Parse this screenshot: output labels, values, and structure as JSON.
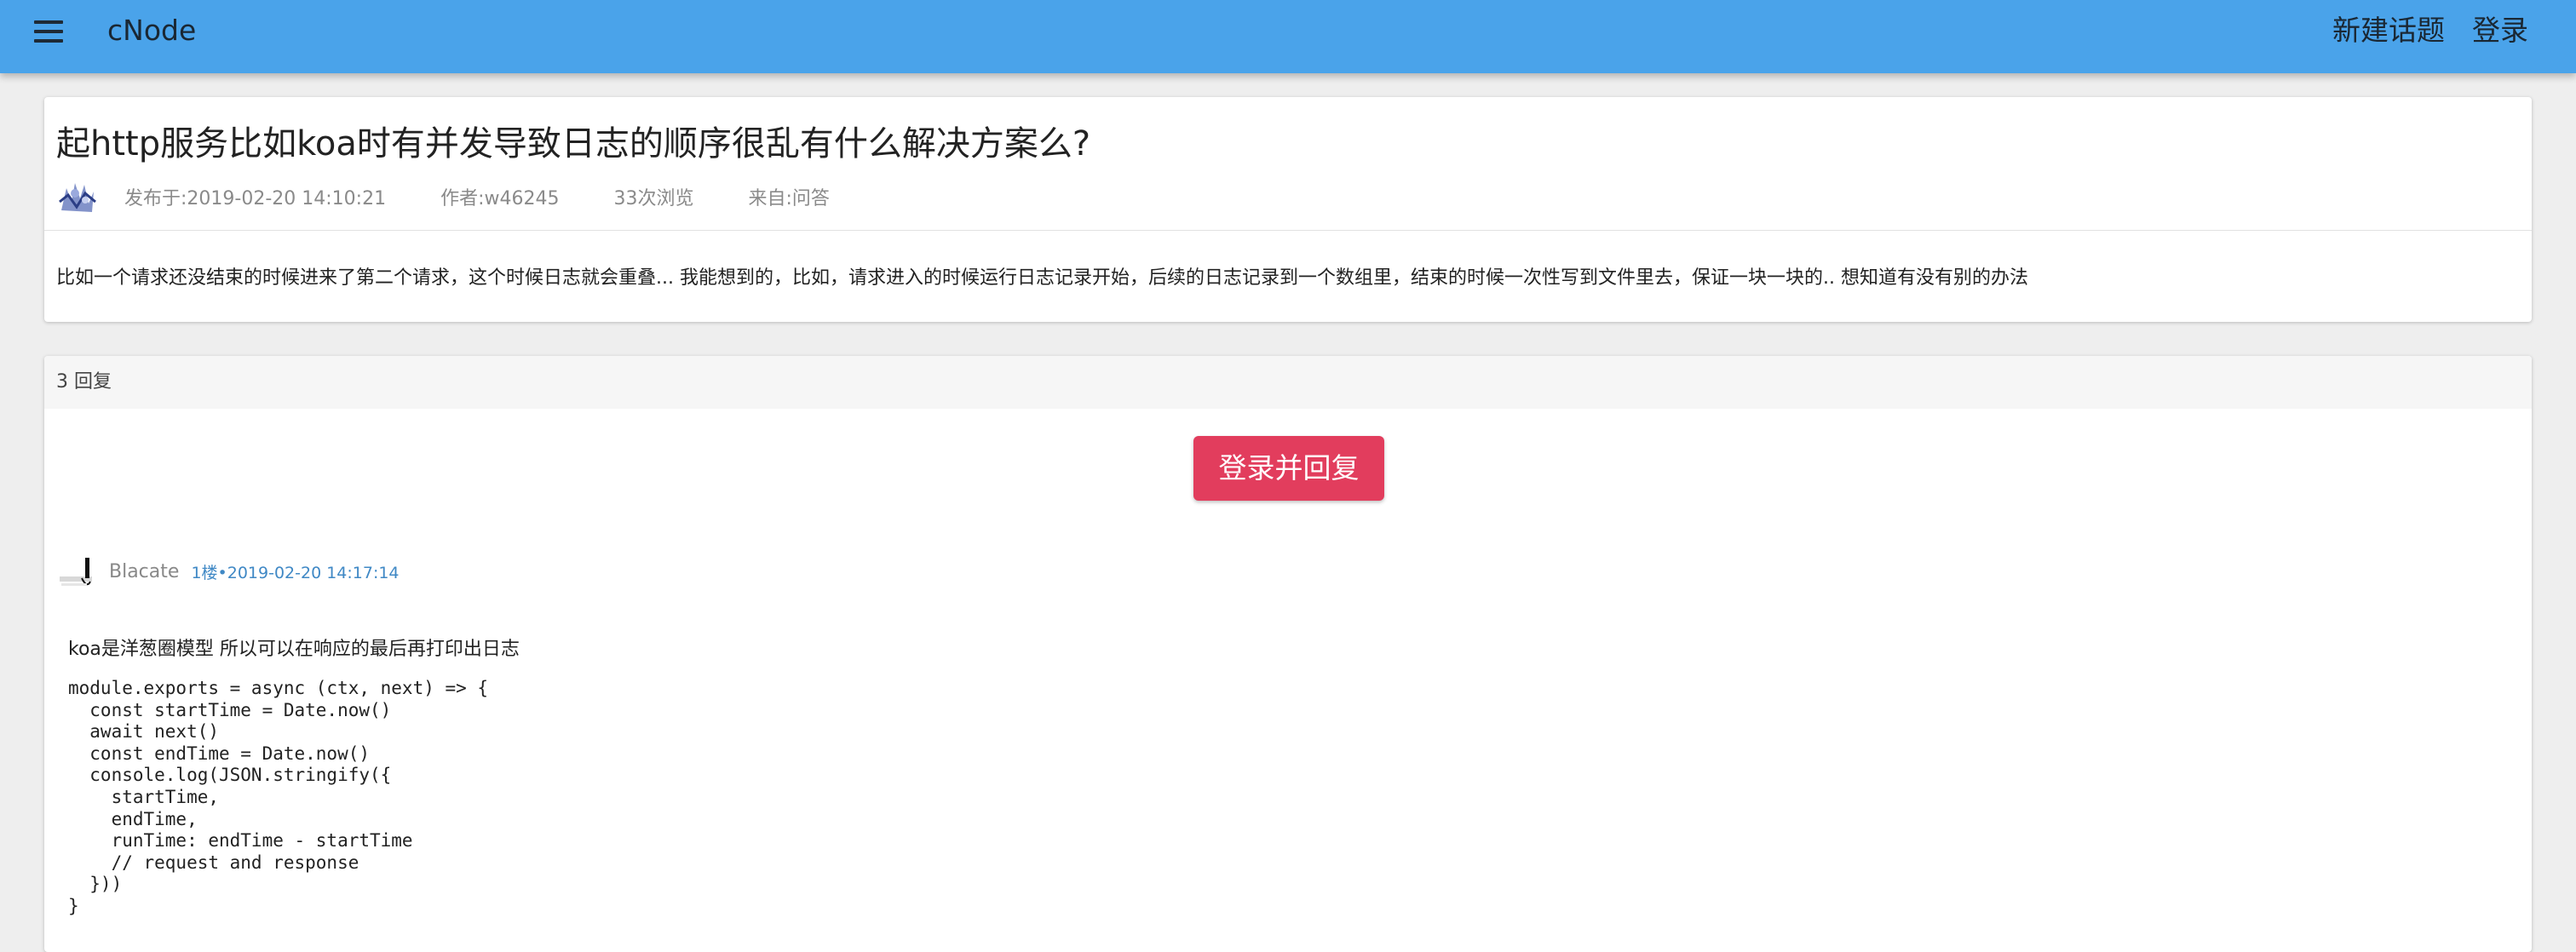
{
  "header": {
    "brand": "cNode",
    "new_topic_label": "新建话题",
    "login_label": "登录",
    "menu_icon": "menu-icon"
  },
  "topic": {
    "title": "起http服务比如koa时有并发导致日志的顺序很乱有什么解决方案么?",
    "published": "发布于:2019-02-20 14:10:21",
    "author": "作者:w46245",
    "views": "33次浏览",
    "source": "来自:问答",
    "content": "比如一个请求还没结束的时候进来了第二个请求，这个时候日志就会重叠... 我能想到的，比如，请求进入的时候运行日志记录开始，后续的日志记录到一个数组里，结束的时候一次性写到文件里去，保证一块一块的.. 想知道有没有别的办法"
  },
  "replies": {
    "count_label": "3 回复",
    "login_reply_label": "登录并回复",
    "accent_color": "#e23d5d",
    "items": [
      {
        "author": "Blacate",
        "floor": "1楼•2019-02-20 14:17:14",
        "text": "koa是洋葱圈模型 所以可以在响应的最后再打印出日志",
        "code": "module.exports = async (ctx, next) => {\n  const startTime = Date.now()\n  await next()\n  const endTime = Date.now()\n  console.log(JSON.stringify({\n    startTime,\n    endTime,\n    runTime: endTime - startTime\n    // request and response\n  }))\n}"
      }
    ]
  },
  "colors": {
    "appbar": "#4aa3ea",
    "floor_link": "#3f88c5"
  }
}
